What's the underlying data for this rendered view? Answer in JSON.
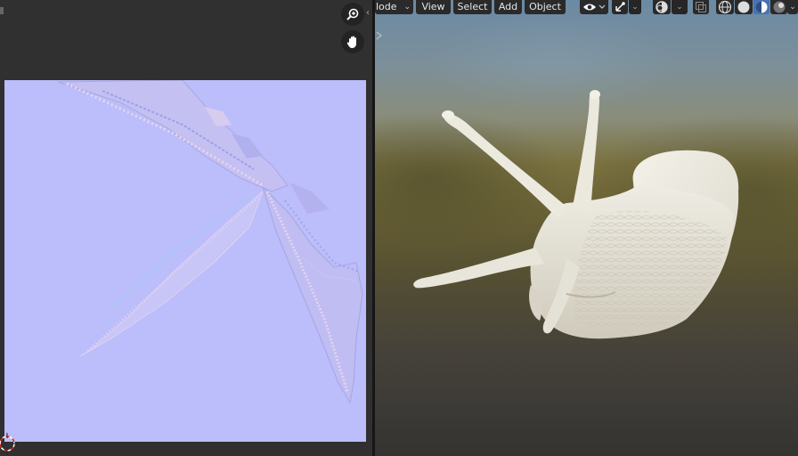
{
  "header": {
    "mode_label": "lode",
    "mode_chevron": "⌄",
    "menus": [
      "View",
      "Select",
      "Add",
      "Object"
    ]
  },
  "image_editor": {
    "icons": [
      "zoom-in-icon",
      "hand-pan-icon",
      "2d-cursor-icon"
    ],
    "texture": "normal-map"
  },
  "viewport": {
    "shading_mode_active": "material-preview",
    "icons": [
      "visibility-eye-icon",
      "gizmo-icon",
      "overlay-icon",
      "xray-icon",
      "wireframe-shading-icon",
      "solid-shading-icon",
      "material-shading-icon",
      "rendered-shading-icon"
    ],
    "object": "snail-model"
  },
  "colors": {
    "normal_map_base": "#bcbdfb",
    "active_shading": "#4772b3",
    "panel_bg": "#303030",
    "header_button": "#2a2a2a"
  }
}
